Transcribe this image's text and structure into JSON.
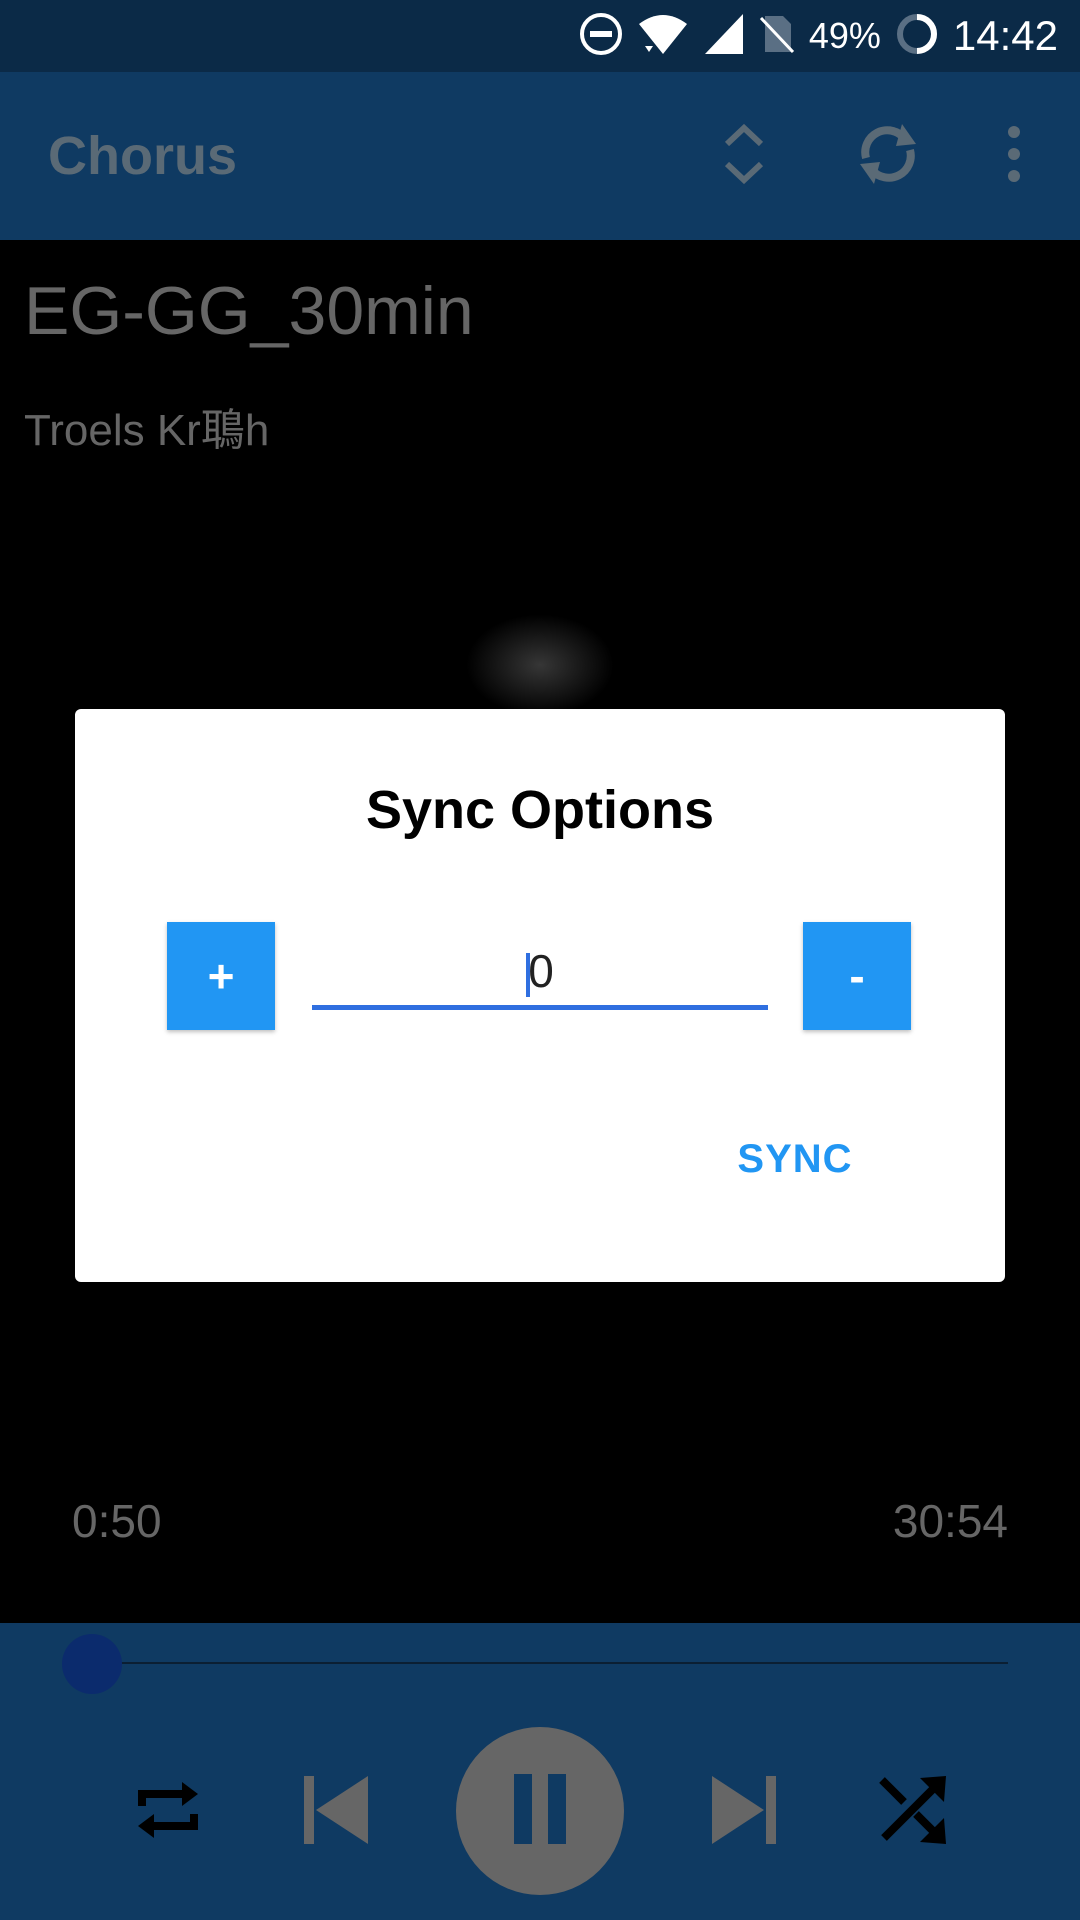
{
  "status_bar": {
    "battery": "49%",
    "time": "14:42",
    "icons": [
      "do-not-disturb-icon",
      "wifi-icon",
      "cell-signal-icon",
      "no-sim-icon",
      "battery-charging-icon"
    ]
  },
  "app_bar": {
    "title": "Chorus",
    "icons": [
      "expand-collapse-icon",
      "sync-icon",
      "more-vert-icon"
    ]
  },
  "track": {
    "title": "EG-GG_30min",
    "artist": "Troels Kr鵈h"
  },
  "player": {
    "elapsed": "0:50",
    "total": "30:54",
    "progress_fraction": 0.027,
    "controls": [
      "repeat-icon",
      "skip-previous-icon",
      "pause-icon",
      "skip-next-icon",
      "shuffle-icon"
    ]
  },
  "dialog": {
    "title": "Sync Options",
    "plus_label": "+",
    "minus_label": "-",
    "value": "0",
    "sync_label": "SYNC"
  },
  "colors": {
    "accent": "#2196f3",
    "app_bar": "#0f3a62",
    "status_bar": "#0b2a47"
  }
}
